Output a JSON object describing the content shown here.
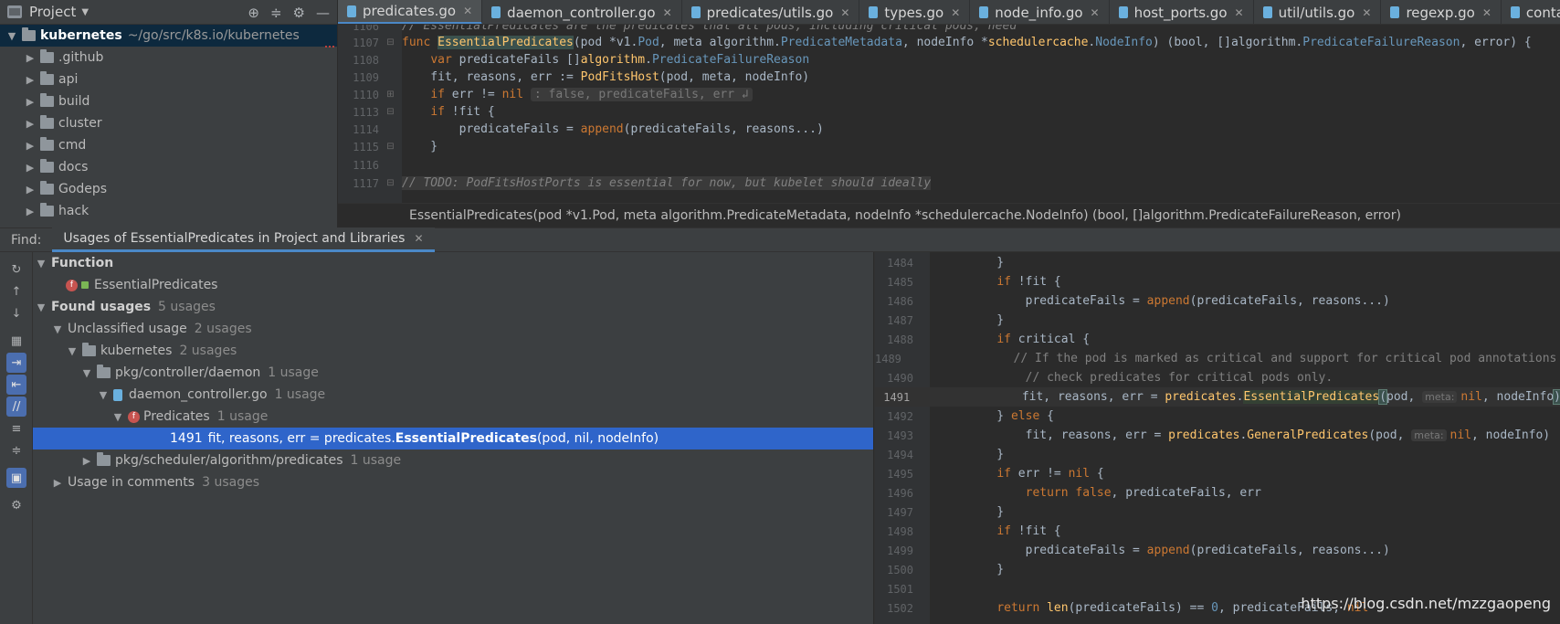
{
  "project": {
    "title": "Project",
    "root": {
      "name": "kubernetes",
      "path": "~/go/src/k8s.io/kubernetes"
    },
    "folders": [
      ".github",
      "api",
      "build",
      "cluster",
      "cmd",
      "docs",
      "Godeps",
      "hack"
    ]
  },
  "tabs": [
    {
      "label": "predicates.go",
      "active": true
    },
    {
      "label": "daemon_controller.go",
      "active": false
    },
    {
      "label": "predicates/utils.go",
      "active": false
    },
    {
      "label": "types.go",
      "active": false
    },
    {
      "label": "node_info.go",
      "active": false
    },
    {
      "label": "host_ports.go",
      "active": false
    },
    {
      "label": "util/utils.go",
      "active": false
    },
    {
      "label": "regexp.go",
      "active": false
    },
    {
      "label": "container_log_manager_stub.go",
      "active": false
    }
  ],
  "editor": {
    "line_1106": "1106",
    "text_1106": "// EssentialPredicates are the predicates that all pods, including critical pods, need",
    "line_1107": "1107",
    "line_1108": "1108",
    "line_1109": "1109",
    "line_1110": "1110",
    "hint_1110": ": false, predicateFails, err ↲",
    "line_1113": "1113",
    "line_1114": "1114",
    "line_1115": "1115",
    "line_1116": "1116",
    "line_1117": "1117",
    "text_1117": "// TODO: PodFitsHostPorts is essential for now, but kubelet should ideally"
  },
  "signature": "EssentialPredicates(pod *v1.Pod, meta algorithm.PredicateMetadata, nodeInfo *schedulercache.NodeInfo) (bool, []algorithm.PredicateFailureReason, error)",
  "find": {
    "label": "Find:",
    "tab_label": "Usages of EssentialPredicates in Project and Libraries",
    "tree": {
      "function_group": "Function",
      "function_name": "EssentialPredicates",
      "found_usages": "Found usages",
      "found_count": "5 usages",
      "unclassified": "Unclassified usage",
      "unclassified_count": "2 usages",
      "module": "kubernetes",
      "module_count": "2 usages",
      "pkg_daemon": "pkg/controller/daemon",
      "pkg_daemon_count": "1 usage",
      "file": "daemon_controller.go",
      "file_count": "1 usage",
      "method": "Predicates",
      "method_count": "1 usage",
      "usage_line": "1491",
      "usage_prefix": "fit, reasons, err = predicates.",
      "usage_match": "EssentialPredicates",
      "usage_suffix": "(pod, nil, nodeInfo)",
      "pkg_sched": "pkg/scheduler/algorithm/predicates",
      "pkg_sched_count": "1 usage",
      "comments": "Usage in comments",
      "comments_count": "3 usages"
    }
  },
  "preview": {
    "lines": [
      "1484",
      "1485",
      "1486",
      "1487",
      "1488",
      "1489",
      "1490",
      "1491",
      "1492",
      "1493",
      "1494",
      "1495",
      "1496",
      "1497",
      "1498",
      "1499",
      "1500",
      "1501",
      "1502"
    ],
    "comment_1489": "// If the pod is marked as critical and support for critical pod annotations is enabled,",
    "comment_1490": "// check predicates for critical pods only.",
    "meta_hint": "meta:"
  },
  "watermark": "https://blog.csdn.net/mzzgaopeng",
  "colors": {
    "accent": "#4a88c7",
    "selection": "#2f65ca",
    "background": "#2b2b2b",
    "panel": "#3c3f41"
  }
}
